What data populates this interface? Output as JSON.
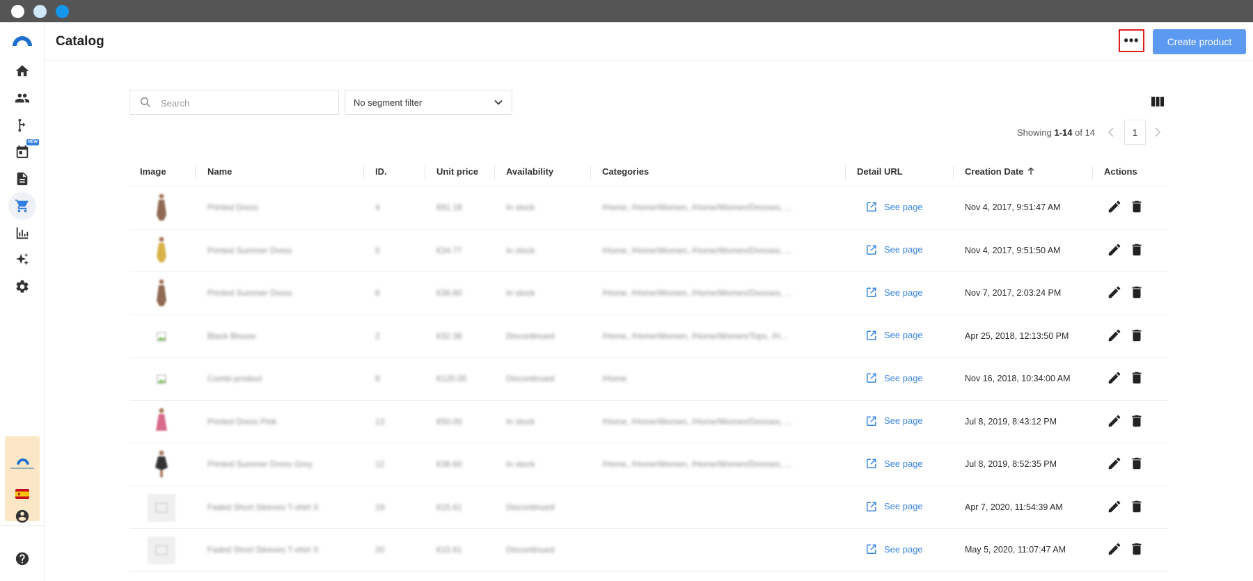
{
  "header": {
    "title": "Catalog",
    "more_label": "•••",
    "create_label": "Create product"
  },
  "sidebar": {
    "new_badge": "NEW",
    "items": [
      {
        "name": "home-icon"
      },
      {
        "name": "users-icon"
      },
      {
        "name": "flow-icon"
      },
      {
        "name": "calendar-icon"
      },
      {
        "name": "document-icon"
      },
      {
        "name": "cart-icon"
      },
      {
        "name": "chart-icon"
      },
      {
        "name": "sparkle-icon"
      },
      {
        "name": "gear-icon"
      }
    ]
  },
  "toolbar": {
    "search_placeholder": "Search",
    "segment_filter": "No segment filter"
  },
  "pagination": {
    "showing_prefix": "Showing ",
    "range": "1-14",
    "of_text": " of 14",
    "page": "1"
  },
  "table": {
    "columns": {
      "image": "Image",
      "name": "Name",
      "id": "ID.",
      "unit_price": "Unit price",
      "availability": "Availability",
      "categories": "Categories",
      "detail_url": "Detail URL",
      "creation_date": "Creation Date",
      "actions": "Actions"
    },
    "link_label": "See page",
    "rows": [
      {
        "name": "Printed Dress",
        "id": "4",
        "price": "€61.18",
        "availability": "In stock",
        "categories": "/Home, /Home/Women, /Home/Women/Dresses, ...",
        "date": "Nov 4, 2017, 9:51:47 AM",
        "image": "dress-brown"
      },
      {
        "name": "Printed Summer Dress",
        "id": "5",
        "price": "€34.77",
        "availability": "In stock",
        "categories": "/Home, /Home/Women, /Home/Women/Dresses, ...",
        "date": "Nov 4, 2017, 9:51:50 AM",
        "image": "dress-yellow"
      },
      {
        "name": "Printed Summer Dress",
        "id": "6",
        "price": "€36.60",
        "availability": "In stock",
        "categories": "/Home, /Home/Women, /Home/Women/Dresses, ...",
        "date": "Nov 7, 2017, 2:03:24 PM",
        "image": "dress-brown"
      },
      {
        "name": "Black Blouse",
        "id": "2",
        "price": "€32.38",
        "availability": "Discontinued",
        "categories": "/Home, /Home/Women, /Home/Women/Tops, /H...",
        "date": "Apr 25, 2018, 12:13:50 PM",
        "image": "broken"
      },
      {
        "name": "Combi product",
        "id": "8",
        "price": "€120.00",
        "availability": "Discontinued",
        "categories": "/Home",
        "date": "Nov 16, 2018, 10:34:00 AM",
        "image": "broken"
      },
      {
        "name": "Printed Dress Pink",
        "id": "13",
        "price": "€50.00",
        "availability": "In stock",
        "categories": "/Home, /Home/Women, /Home/Women/Dresses, ...",
        "date": "Jul 8, 2019, 8:43:12 PM",
        "image": "dress-pink"
      },
      {
        "name": "Printed Summer Dress Grey",
        "id": "12",
        "price": "€36.60",
        "availability": "In stock",
        "categories": "/Home, /Home/Women, /Home/Women/Dresses, ...",
        "date": "Jul 8, 2019, 8:52:35 PM",
        "image": "dress-black"
      },
      {
        "name": "Faded Short Sleeves T-shirt X",
        "id": "19",
        "price": "€15.61",
        "availability": "Discontinued",
        "categories": "",
        "date": "Apr 7, 2020, 11:54:39 AM",
        "image": "placeholder"
      },
      {
        "name": "Faded Short Sleeves T-shirt X",
        "id": "20",
        "price": "€15.61",
        "availability": "Discontinued",
        "categories": "",
        "date": "May 5, 2020, 11:07:47 AM",
        "image": "placeholder"
      }
    ]
  },
  "colors": {
    "accent": "#2f7ee0",
    "create_button": "#5b9af0",
    "highlight_border": "#e01b1b",
    "link": "#3a85e3"
  }
}
